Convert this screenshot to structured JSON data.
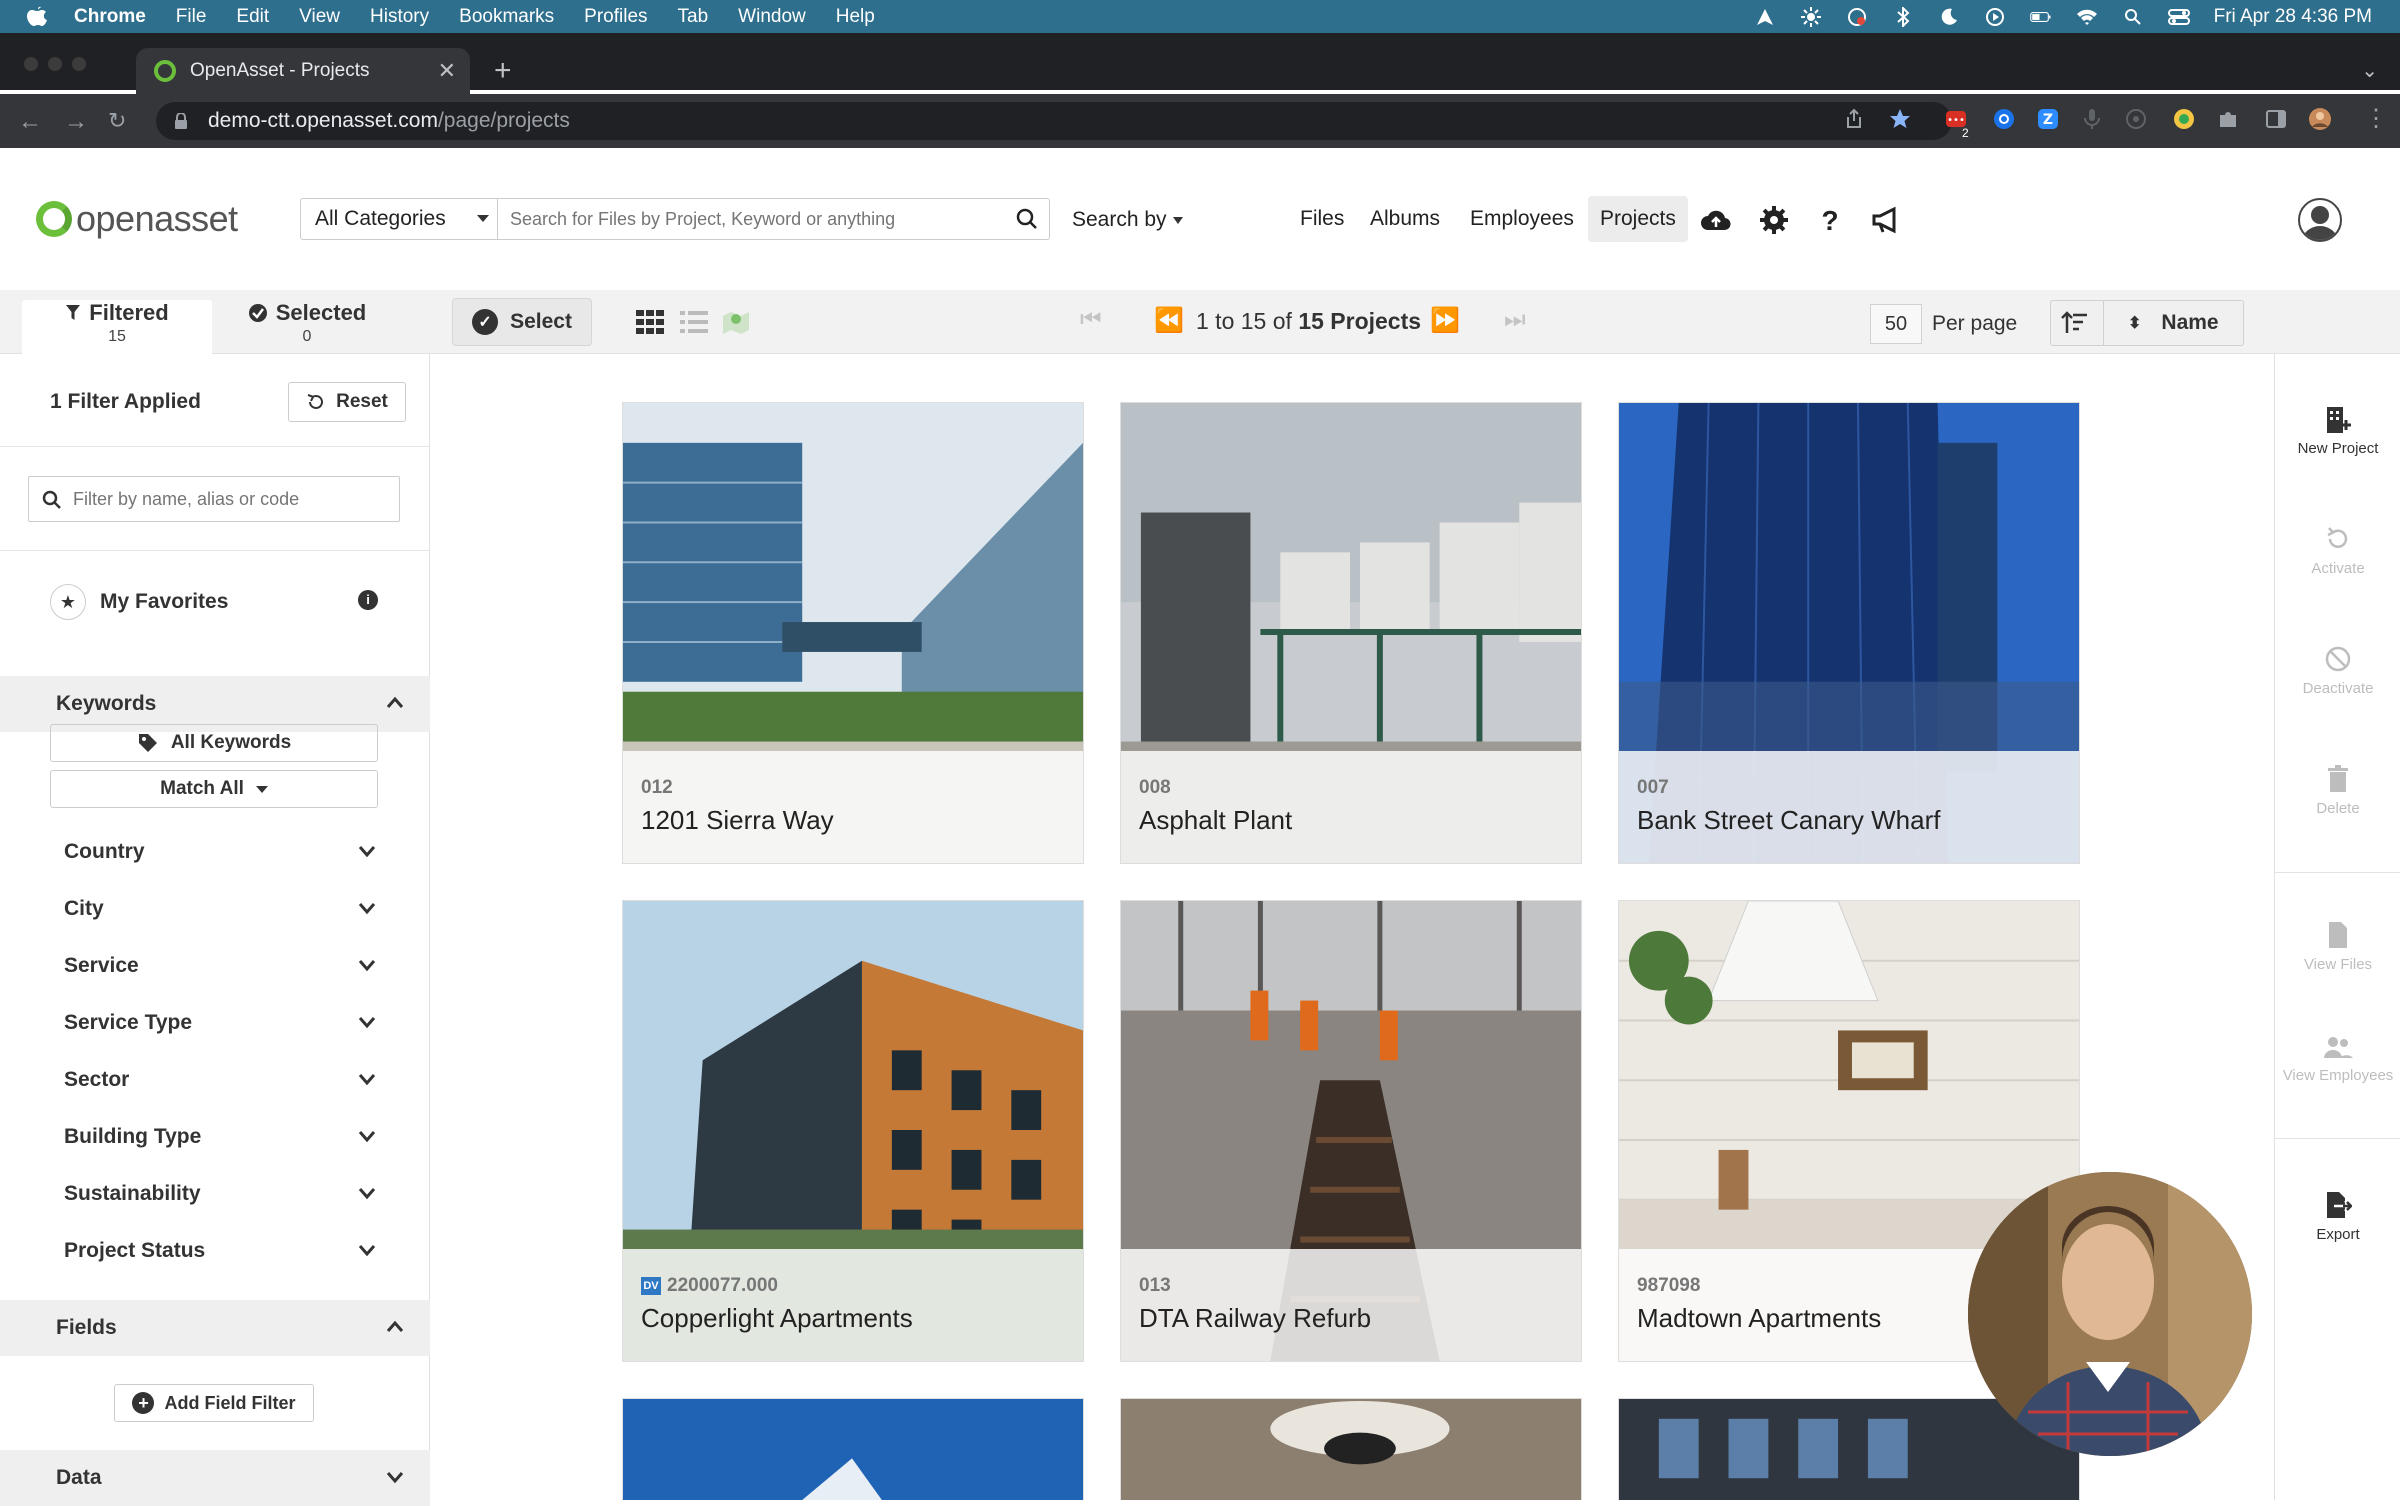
{
  "os_menubar": {
    "app_name": "Chrome",
    "menus": [
      "File",
      "Edit",
      "View",
      "History",
      "Bookmarks",
      "Profiles",
      "Tab",
      "Window",
      "Help"
    ],
    "clock": "Fri Apr 28  4:36 PM",
    "status_icons": [
      "arrow-icon",
      "brightness-icon",
      "cast-icon",
      "bluetooth-icon",
      "moon-icon",
      "play-icon",
      "battery-icon",
      "wifi-icon",
      "spotlight-icon",
      "control-center-icon"
    ]
  },
  "browser": {
    "tab_title": "OpenAsset - Projects",
    "url_host": "demo-ctt.openasset.com",
    "url_path": "/page/projects",
    "extension_badge": "2"
  },
  "header": {
    "logo_text": "openasset",
    "category_select": "All Categories",
    "search_placeholder": "Search for Files by Project, Keyword or anything",
    "search_by": "Search by",
    "nav": [
      "Files",
      "Albums",
      "Employees",
      "Projects"
    ],
    "active_nav": "Projects"
  },
  "subbar": {
    "filtered_label": "Filtered",
    "filtered_count": "15",
    "selected_label": "Selected",
    "selected_count": "0",
    "select_button": "Select",
    "page_range": "1 to 15 of",
    "page_total": "15 Projects",
    "per_page_value": "50",
    "per_page_label": "Per page",
    "sort_field": "Name"
  },
  "sidebar": {
    "filters_applied": "1 Filter Applied",
    "reset": "Reset",
    "filter_placeholder": "Filter by name, alias or code",
    "favorites": "My Favorites",
    "keywords_header": "Keywords",
    "all_keywords": "All Keywords",
    "match_all": "Match All",
    "facets": [
      "Country",
      "City",
      "Service",
      "Service Type",
      "Sector",
      "Building Type",
      "Sustainability",
      "Project Status"
    ],
    "fields_header": "Fields",
    "add_field_filter": "Add Field Filter",
    "data_header": "Data"
  },
  "projects": [
    {
      "code": "012",
      "name": "1201 Sierra Way"
    },
    {
      "code": "008",
      "name": "Asphalt Plant"
    },
    {
      "code": "007",
      "name": "Bank Street Canary Wharf"
    },
    {
      "code": "2200077.000",
      "name": "Copperlight Apartments",
      "badge": "DV"
    },
    {
      "code": "013",
      "name": "DTA Railway Refurb"
    },
    {
      "code": "987098",
      "name": "Madtown Apartments"
    }
  ],
  "rail_actions": [
    {
      "label": "New Project",
      "enabled": true
    },
    {
      "label": "Activate",
      "enabled": false
    },
    {
      "label": "Deactivate",
      "enabled": false
    },
    {
      "label": "Delete",
      "enabled": false
    },
    {
      "label": "View Files",
      "enabled": false
    },
    {
      "label": "View Employees",
      "enabled": false
    },
    {
      "label": "Export",
      "enabled": true
    }
  ],
  "colors": {
    "menubar": "#2f6f8e",
    "brand_green": "#6cbf3a",
    "chrome_dark": "#202124",
    "chrome_toolbar": "#35363a",
    "subbar": "#f2f2f2"
  }
}
